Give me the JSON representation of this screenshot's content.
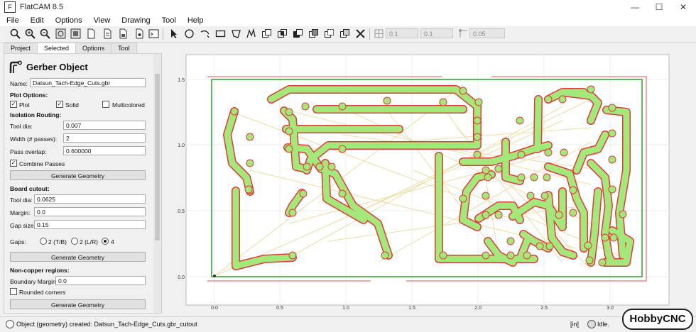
{
  "window": {
    "title": "FlatCAM 8.5",
    "minimize": "—",
    "maximize": "☐",
    "close": "✕"
  },
  "menu": [
    "File",
    "Edit",
    "Options",
    "View",
    "Drawing",
    "Tool",
    "Help"
  ],
  "toolbar": {
    "tools": [
      {
        "name": "zoom-fit-icon"
      },
      {
        "name": "zoom-in-icon"
      },
      {
        "name": "zoom-out-icon"
      },
      {
        "name": "replot-icon"
      },
      {
        "name": "clear-plot-icon"
      },
      {
        "name": "new-document-icon"
      },
      {
        "name": "open-file-icon"
      },
      {
        "name": "save-file-icon"
      },
      {
        "name": "shell-icon"
      }
    ],
    "drawing_tools": [
      {
        "name": "select-arrow-icon"
      },
      {
        "name": "circle-icon"
      },
      {
        "name": "arc-icon"
      },
      {
        "name": "rectangle-icon"
      },
      {
        "name": "polygon-icon"
      },
      {
        "name": "path-icon"
      },
      {
        "name": "union-icon"
      },
      {
        "name": "intersection-icon"
      },
      {
        "name": "subtract-icon"
      },
      {
        "name": "cut-icon"
      },
      {
        "name": "move-icon"
      },
      {
        "name": "copy-icon"
      },
      {
        "name": "delete-icon"
      }
    ],
    "grid_x": "0.1",
    "grid_y": "0.1",
    "snap_max": "0.05"
  },
  "tabs": [
    "Project",
    "Selected",
    "Options",
    "Tool"
  ],
  "active_tab": "Selected",
  "panel": {
    "heading": "Gerber Object",
    "name_label": "Name:",
    "name_value": "Datsun_Tach-Edge_Cuts.gbr",
    "plot_options_label": "Plot Options:",
    "plot_label": "Plot",
    "plot_checked": true,
    "solid_label": "Solid",
    "solid_checked": true,
    "multicolored_label": "Multicolored",
    "multicolored_checked": false,
    "isolation_label": "Isolation Routing:",
    "tool_dia_label": "Tool dia:",
    "tool_dia_value": "0.007",
    "width_label": "Width (# passes):",
    "width_value": "2",
    "overlap_label": "Pass overlap:",
    "overlap_value": "0.600000",
    "combine_label": "Combine Passes",
    "combine_checked": true,
    "generate_geometry_1": "Generate Geometry",
    "board_cutout_label": "Board cutout:",
    "cut_tool_dia_label": "Tool dia:",
    "cut_tool_dia_value": "0.0625",
    "margin_label": "Margin:",
    "margin_value": "0.0",
    "gap_size_label": "Gap size:",
    "gap_size_value": "0.15",
    "gaps_label": "Gaps:",
    "gap_options": [
      "2 (T/B)",
      "2 (L/R)",
      "4"
    ],
    "gap_selected": "4",
    "generate_geometry_2": "Generate Geometry",
    "noncopper_label": "Non-copper regions:",
    "boundary_label": "Boundary Margin:",
    "boundary_value": "0.0",
    "rounded_label": "Rounded corners",
    "rounded_checked": false,
    "generate_geometry_3": "Generate Geometry"
  },
  "plot": {
    "x_ticks": [
      "0.0",
      "0.5",
      "1.0",
      "1.5",
      "2.0",
      "2.5",
      "3.0"
    ],
    "y_ticks": [
      "1.5",
      "1.0",
      "0.5",
      "0.0"
    ],
    "colors": {
      "trace_fill": "#a4e77a",
      "trace_edge": "#e23b3b",
      "outline": "#3aa33a",
      "cutout": "#e05050",
      "ratsnest": "#e8dca0"
    }
  },
  "status": {
    "message": "Object (geometry) created: Datsun_Tach-Edge_Cuts.gbr_cutout",
    "units": "[in]",
    "state": "Idle.",
    "logo": "HobbyCNC"
  }
}
